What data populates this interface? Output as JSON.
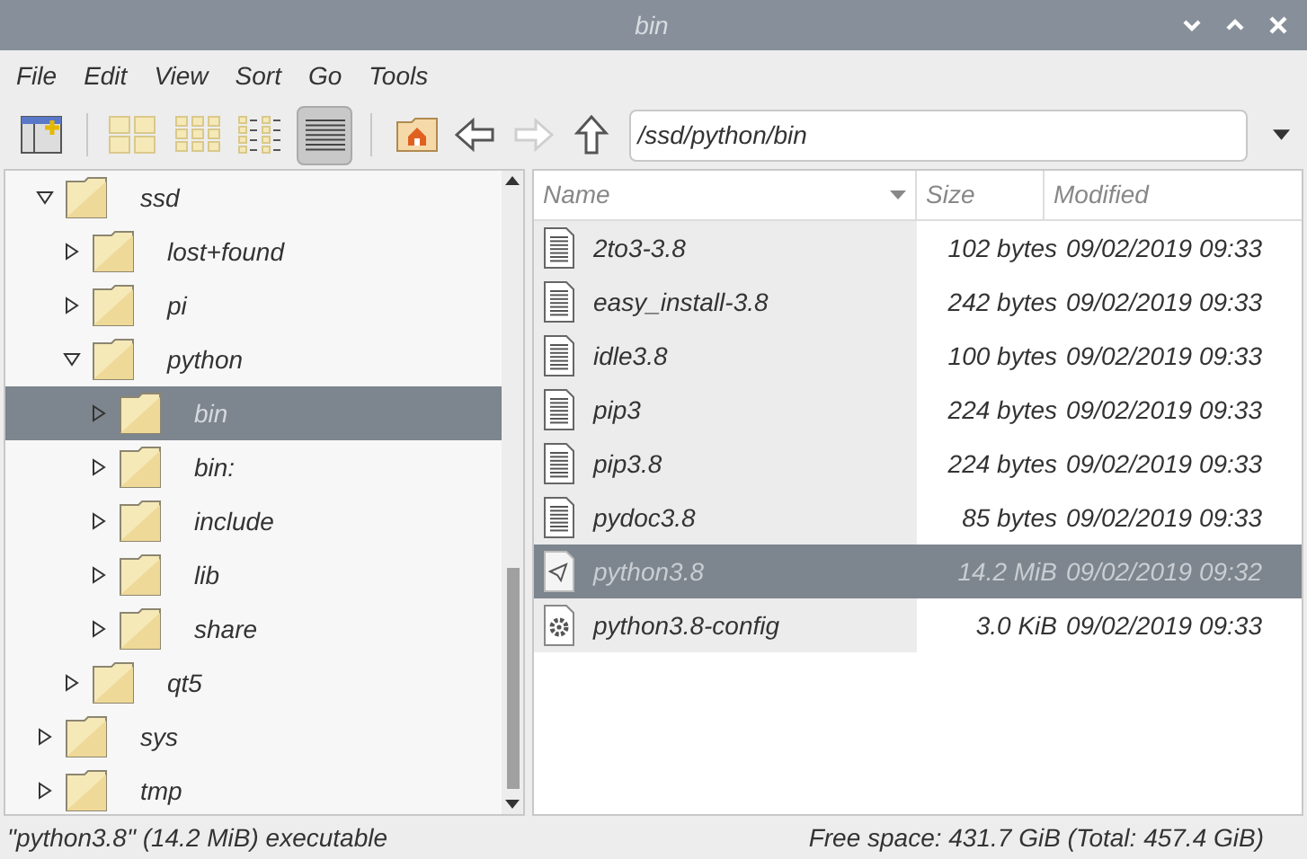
{
  "window": {
    "title": "bin"
  },
  "menu": [
    "File",
    "Edit",
    "View",
    "Sort",
    "Go",
    "Tools"
  ],
  "toolbar": {
    "view_modes": [
      {
        "kind": "icons",
        "selected": false
      },
      {
        "kind": "thumbnails",
        "selected": false
      },
      {
        "kind": "compact",
        "selected": false
      },
      {
        "kind": "list",
        "selected": true
      }
    ],
    "forward_disabled": true,
    "path": "/ssd/python/bin"
  },
  "tree": [
    {
      "label": "ssd",
      "expanded": true,
      "selected": false,
      "children": [
        {
          "label": "lost+found",
          "expanded": false,
          "selected": false
        },
        {
          "label": "pi",
          "expanded": false,
          "selected": false
        },
        {
          "label": "python",
          "expanded": true,
          "selected": false,
          "children": [
            {
              "label": "bin",
              "expanded": false,
              "selected": true
            },
            {
              "label": "bin:",
              "expanded": false,
              "selected": false
            },
            {
              "label": "include",
              "expanded": false,
              "selected": false
            },
            {
              "label": "lib",
              "expanded": false,
              "selected": false
            },
            {
              "label": "share",
              "expanded": false,
              "selected": false
            }
          ]
        },
        {
          "label": "qt5",
          "expanded": false,
          "selected": false
        }
      ]
    },
    {
      "label": "sys",
      "expanded": false,
      "selected": false
    },
    {
      "label": "tmp",
      "expanded": false,
      "selected": false
    }
  ],
  "files": {
    "columns": [
      "Name",
      "Size",
      "Modified"
    ],
    "rows": [
      {
        "kind": "script",
        "name": "2to3-3.8",
        "size": "102 bytes",
        "modified": "09/02/2019 09:33",
        "selected": false
      },
      {
        "kind": "script",
        "name": "easy_install-3.8",
        "size": "242 bytes",
        "modified": "09/02/2019 09:33",
        "selected": false
      },
      {
        "kind": "script",
        "name": "idle3.8",
        "size": "100 bytes",
        "modified": "09/02/2019 09:33",
        "selected": false
      },
      {
        "kind": "script",
        "name": "pip3",
        "size": "224 bytes",
        "modified": "09/02/2019 09:33",
        "selected": false
      },
      {
        "kind": "script",
        "name": "pip3.8",
        "size": "224 bytes",
        "modified": "09/02/2019 09:33",
        "selected": false
      },
      {
        "kind": "script",
        "name": "pydoc3.8",
        "size": "85 bytes",
        "modified": "09/02/2019 09:33",
        "selected": false
      },
      {
        "kind": "executable",
        "name": "python3.8",
        "size": "14.2 MiB",
        "modified": "09/02/2019 09:32",
        "selected": true
      },
      {
        "kind": "config",
        "name": "python3.8-config",
        "size": "3.0 KiB",
        "modified": "09/02/2019 09:33",
        "selected": false
      }
    ]
  },
  "status_bar": {
    "selection": "\"python3.8\" (14.2 MiB) executable",
    "free_space": "Free space: 431.7 GiB (Total: 457.4 GiB)"
  }
}
